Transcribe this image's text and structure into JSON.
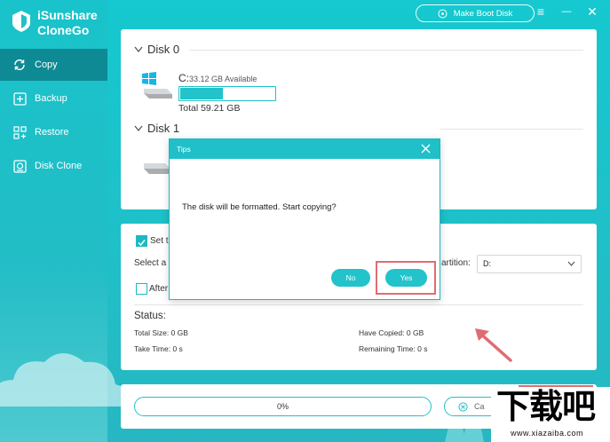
{
  "app": {
    "name_line1": "iSunshare",
    "name_line2": "CloneGo"
  },
  "nav": {
    "items": [
      {
        "label": "Copy",
        "icon": "copy-icon",
        "active": true
      },
      {
        "label": "Backup",
        "icon": "backup-icon",
        "active": false
      },
      {
        "label": "Restore",
        "icon": "restore-icon",
        "active": false
      },
      {
        "label": "Disk Clone",
        "icon": "disk-clone-icon",
        "active": false
      }
    ]
  },
  "topbar": {
    "boot_button_label": "Make Boot Disk",
    "menu_icon": "≡",
    "minimize_icon": "—",
    "close_icon": "✕"
  },
  "disks": {
    "disk0": {
      "title": "Disk 0",
      "drive_letter": "C:",
      "available": "33.12 GB Available",
      "total": "Total 59.21 GB",
      "used_fraction": 0.44
    },
    "disk1": {
      "title": "Disk 1"
    }
  },
  "options": {
    "set_label": "Set t",
    "select_label": "Select a",
    "partition_label": "artition:",
    "partition_value": "D:",
    "after_label": "After"
  },
  "status": {
    "title": "Status:",
    "total_size": "Total Size: 0 GB",
    "have_copied": "Have Copied: 0 GB",
    "take_time": "Take Time: 0 s",
    "remaining_time": "Remaining Time: 0 s"
  },
  "bottom": {
    "progress_text": "0%",
    "cancel_label": "Ca"
  },
  "dialog": {
    "title": "Tips",
    "message": "The disk will be formatted. Start copying?",
    "no_label": "No",
    "yes_label": "Yes"
  },
  "watermark": {
    "big_text": "下载吧",
    "url": "www.xiazaiba.com"
  },
  "colors": {
    "accent": "#1fc0c8",
    "active_nav": "#0d8a93",
    "highlight_red": "#e06c73"
  }
}
